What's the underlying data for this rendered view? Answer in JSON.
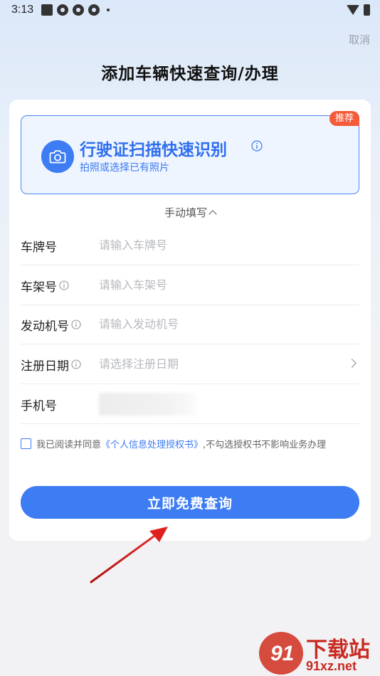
{
  "status_bar": {
    "time": "3:13"
  },
  "header": {
    "cancel_label": "取消",
    "title": "添加车辆快速查询/办理"
  },
  "scan": {
    "badge": "推荐",
    "title": "行驶证扫描快速识别",
    "subtitle": "拍照或选择已有照片"
  },
  "manual_toggle": "手动填写",
  "form": {
    "plate": {
      "label": "车牌号",
      "placeholder": "请输入车牌号"
    },
    "vin": {
      "label": "车架号",
      "placeholder": "请输入车架号"
    },
    "engine": {
      "label": "发动机号",
      "placeholder": "请输入发动机号"
    },
    "reg_date": {
      "label": "注册日期",
      "placeholder": "请选择注册日期"
    },
    "phone": {
      "label": "手机号"
    }
  },
  "agreement": {
    "prefix": "我已阅读并同意",
    "link": "《个人信息处理授权书》",
    "suffix": ",不勾选授权书不影响业务办理"
  },
  "submit_label": "立即免费查询",
  "watermark": {
    "logo": "91",
    "title": "下载站",
    "url": "91xz.net"
  },
  "colors": {
    "accent": "#3d7cf2",
    "badge": "#f35b3b",
    "arrow": "#e02020"
  }
}
